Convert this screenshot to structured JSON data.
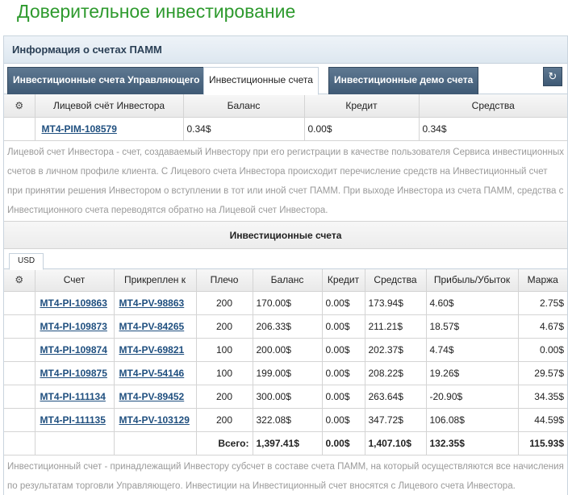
{
  "page_title": "Доверительное инвестирование",
  "panel": {
    "title": "Информация о счетах ПАММ",
    "tabs": [
      {
        "label": "Инвестиционные счета Управляющего",
        "active": false
      },
      {
        "label": "Инвестиционные счета",
        "active": true
      },
      {
        "label": "Инвестиционные демо счета",
        "active": false
      }
    ],
    "refresh_icon": "refresh-icon"
  },
  "personal": {
    "headers": [
      "Лицевой счёт Инвестора",
      "Баланс",
      "Кредит",
      "Средства"
    ],
    "row": {
      "account": "MT4-PIM-108579",
      "balance": "0.34$",
      "credit": "0.00$",
      "equity": "0.34$"
    },
    "note": "Лицевой счет Инвестора - счет, создаваемый Инвестору при его регистрации в качестве пользователя Сервиса инвестиционных счетов в личном профиле клиента. С Лицевого счета Инвестора происходит перечисление средств на Инвестиционный счет при принятии решения Инвестором о вступлении в тот или иной счет ПАММ. При выходе Инвестора из счета ПАММ, средства с Инвестиционного счета переводятся обратно на Лицевой счет Инвестора."
  },
  "invest": {
    "section_title": "Инвестиционные счета",
    "currency_tab": "USD",
    "headers": [
      "Счет",
      "Прикреплен к",
      "Плечо",
      "Баланс",
      "Кредит",
      "Средства",
      "Прибыль/Убыток",
      "Маржа"
    ],
    "rows": [
      [
        "MT4-PI-109863",
        "MT4-PV-98863",
        "200",
        "170.00$",
        "0.00$",
        "173.94$",
        "4.60$",
        "2.75$"
      ],
      [
        "MT4-PI-109873",
        "MT4-PV-84265",
        "200",
        "206.33$",
        "0.00$",
        "211.21$",
        "18.57$",
        "4.67$"
      ],
      [
        "MT4-PI-109874",
        "MT4-PV-69821",
        "100",
        "200.00$",
        "0.00$",
        "202.37$",
        "4.74$",
        "0.00$"
      ],
      [
        "MT4-PI-109875",
        "MT4-PV-54146",
        "100",
        "199.00$",
        "0.00$",
        "208.22$",
        "19.26$",
        "29.57$"
      ],
      [
        "MT4-PI-111134",
        "MT4-PV-89452",
        "200",
        "300.00$",
        "0.00$",
        "263.64$",
        "-20.90$",
        "34.35$"
      ],
      [
        "MT4-PI-111135",
        "MT4-PV-103129",
        "200",
        "322.08$",
        "0.00$",
        "347.72$",
        "106.08$",
        "44.59$"
      ]
    ],
    "total": {
      "label": "Всего:",
      "balance": "1,397.41$",
      "credit": "0.00$",
      "equity": "1,407.10$",
      "profit": "132.35$",
      "margin": "115.93$"
    },
    "note": "Инвестиционный счет - принадлежащий Инвестору субсчет в составе счета ПАММ, на который осуществляются все начисления по результатам торговли Управляющего. Инвестиции на Инвестиционный счет вносятся с Лицевого счета Инвестора."
  }
}
